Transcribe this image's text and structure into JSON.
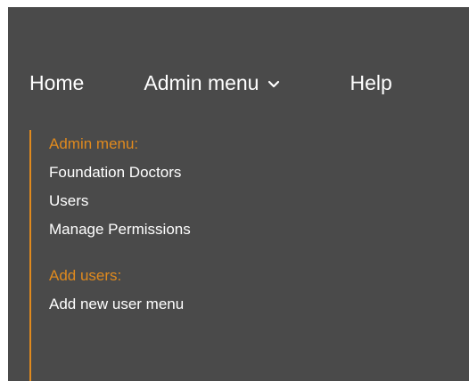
{
  "nav": {
    "home": "Home",
    "admin_menu": "Admin menu",
    "help": "Help",
    "chevron_icon": "chevron-down-icon"
  },
  "dropdown": {
    "sections": [
      {
        "label": "Admin menu:",
        "items": [
          "Foundation Doctors",
          "Users",
          "Manage Permissions"
        ]
      },
      {
        "label": "Add users:",
        "items": [
          "Add new user menu"
        ]
      }
    ]
  },
  "colors": {
    "background": "#4a4a4a",
    "accent": "#e08a1e",
    "text": "#ffffff"
  }
}
